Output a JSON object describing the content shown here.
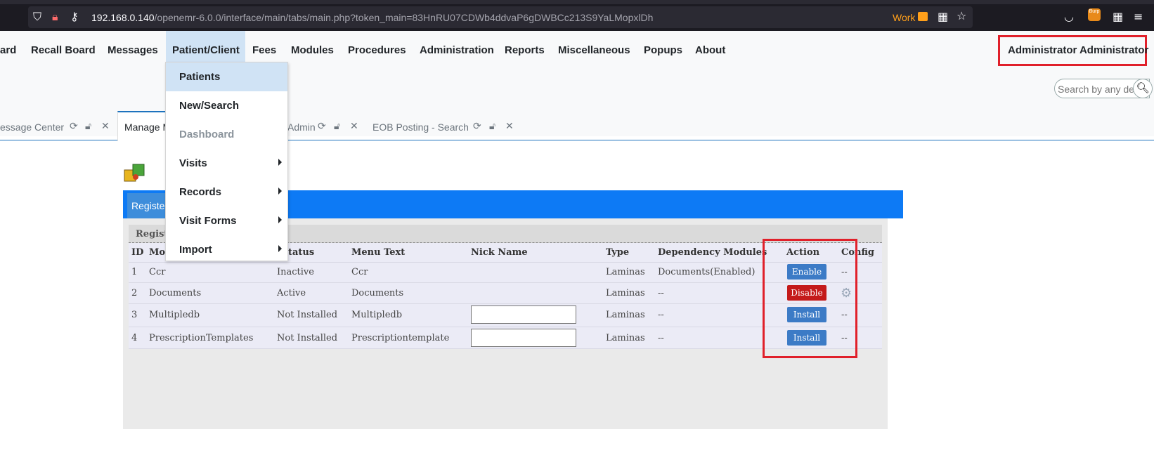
{
  "browser": {
    "url_host": "192.168.0.140",
    "url_path": "/openemr-6.0.0/interface/main/tabs/main.php?token_main=83HnRU07CDWb4ddvaP6gDWBCc213S9YaLMopxlDh",
    "container_label": "Work",
    "extension_badge": "Burp"
  },
  "nav": {
    "items": [
      "ard",
      "Recall Board",
      "Messages",
      "Patient/Client",
      "Fees",
      "Modules",
      "Procedures",
      "Administration",
      "Reports",
      "Miscellaneous",
      "Popups",
      "About"
    ],
    "user": "Administrator Administrator",
    "search_placeholder": "Search by any de"
  },
  "tabs": {
    "message_center": "essage Center",
    "manage": "Manage M",
    "admin": "Admin",
    "eob": "EOB Posting - Search"
  },
  "dropdown": {
    "items": [
      "Patients",
      "New/Search",
      "Dashboard",
      "Visits",
      "Records",
      "Visit Forms",
      "Import"
    ]
  },
  "modules": {
    "register_tab": "Registere",
    "section_title": "Regist",
    "headers": [
      "ID",
      "Mod",
      "tatus",
      "Menu Text",
      "Nick Name",
      "Type",
      "Dependency Modules",
      "Action",
      "Config"
    ],
    "rows": [
      {
        "id": "1",
        "name": "Ccr",
        "status": "Inactive",
        "menu": "Ccr",
        "type": "Laminas",
        "dep": "Documents(Enabled)",
        "action": "Enable",
        "config": "--"
      },
      {
        "id": "2",
        "name": "Documents",
        "status": "Active",
        "menu": "Documents",
        "type": "Laminas",
        "dep": "--",
        "action": "Disable",
        "config": ""
      },
      {
        "id": "3",
        "name": "Multipledb",
        "status": "Not Installed",
        "menu": "Multipledb",
        "type": "Laminas",
        "dep": "--",
        "action": "Install",
        "config": "--"
      },
      {
        "id": "4",
        "name": "PrescriptionTemplates",
        "status": "Not Installed",
        "menu": "Prescriptiontemplate",
        "type": "Laminas",
        "dep": "--",
        "action": "Install",
        "config": "--"
      }
    ]
  }
}
